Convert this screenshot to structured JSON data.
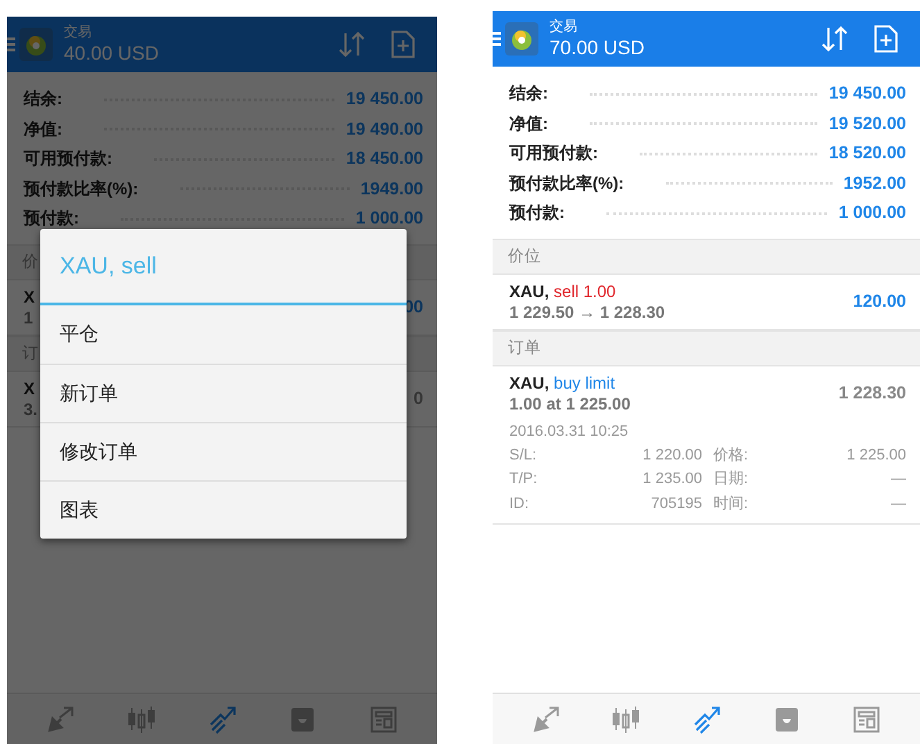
{
  "screens": [
    {
      "dimmed": true,
      "header": {
        "title": "交易",
        "balance": "40.00 USD"
      },
      "account": [
        {
          "label": "结余:",
          "value": "19 450.00"
        },
        {
          "label": "净值:",
          "value": "19 490.00"
        },
        {
          "label": "可用预付款:",
          "value": "18 450.00"
        },
        {
          "label": "预付款比率(%):",
          "value": "1949.00"
        },
        {
          "label": "预付款:",
          "value": "1 000.00"
        }
      ],
      "positions": {
        "header": "价",
        "items": [
          {
            "symbol": "X",
            "line2": "1",
            "value": "00"
          }
        ]
      },
      "orders": {
        "header": "订",
        "items": [
          {
            "symbol": "X",
            "line2": "3.",
            "value": "0"
          }
        ]
      },
      "dialog": {
        "title": "XAU, sell",
        "items": [
          "平仓",
          "新订单",
          "修改订单",
          "图表"
        ]
      },
      "nav": [
        {
          "kind": "trade-arrows",
          "selected": false
        },
        {
          "kind": "candles",
          "selected": false
        },
        {
          "kind": "chart-up",
          "selected": true
        },
        {
          "kind": "tray",
          "selected": false
        },
        {
          "kind": "news",
          "selected": false
        }
      ]
    },
    {
      "dimmed": false,
      "header": {
        "title": "交易",
        "balance": "70.00 USD"
      },
      "account": [
        {
          "label": "结余:",
          "value": "19 450.00"
        },
        {
          "label": "净值:",
          "value": "19 520.00"
        },
        {
          "label": "可用预付款:",
          "value": "18 520.00"
        },
        {
          "label": "预付款比率(%):",
          "value": "1952.00"
        },
        {
          "label": "预付款:",
          "value": "1 000.00"
        }
      ],
      "positions": {
        "header": "价位",
        "items": [
          {
            "symbol": "XAU,",
            "action": "sell 1.00",
            "kind": "sell",
            "line2": "1 229.50 → 1 228.30",
            "value": "120.00"
          }
        ]
      },
      "orders": {
        "header": "订单",
        "items": [
          {
            "symbol": "XAU,",
            "action": "buy limit",
            "kind": "buy",
            "line2": "1.00 at 1 225.00",
            "value": "1 228.30",
            "time": "2016.03.31 10:25",
            "details": [
              {
                "label": "S/L:",
                "value": "1 220.00"
              },
              {
                "label": "价格:",
                "value": "1 225.00"
              },
              {
                "label": "T/P:",
                "value": "1 235.00"
              },
              {
                "label": "日期:",
                "value": "—"
              },
              {
                "label": "ID:",
                "value": "705195"
              },
              {
                "label": "时间:",
                "value": "—"
              }
            ]
          }
        ]
      },
      "nav": [
        {
          "kind": "trade-arrows",
          "selected": false
        },
        {
          "kind": "candles",
          "selected": false
        },
        {
          "kind": "chart-up",
          "selected": true
        },
        {
          "kind": "tray",
          "selected": false
        },
        {
          "kind": "news",
          "selected": false
        }
      ]
    }
  ]
}
